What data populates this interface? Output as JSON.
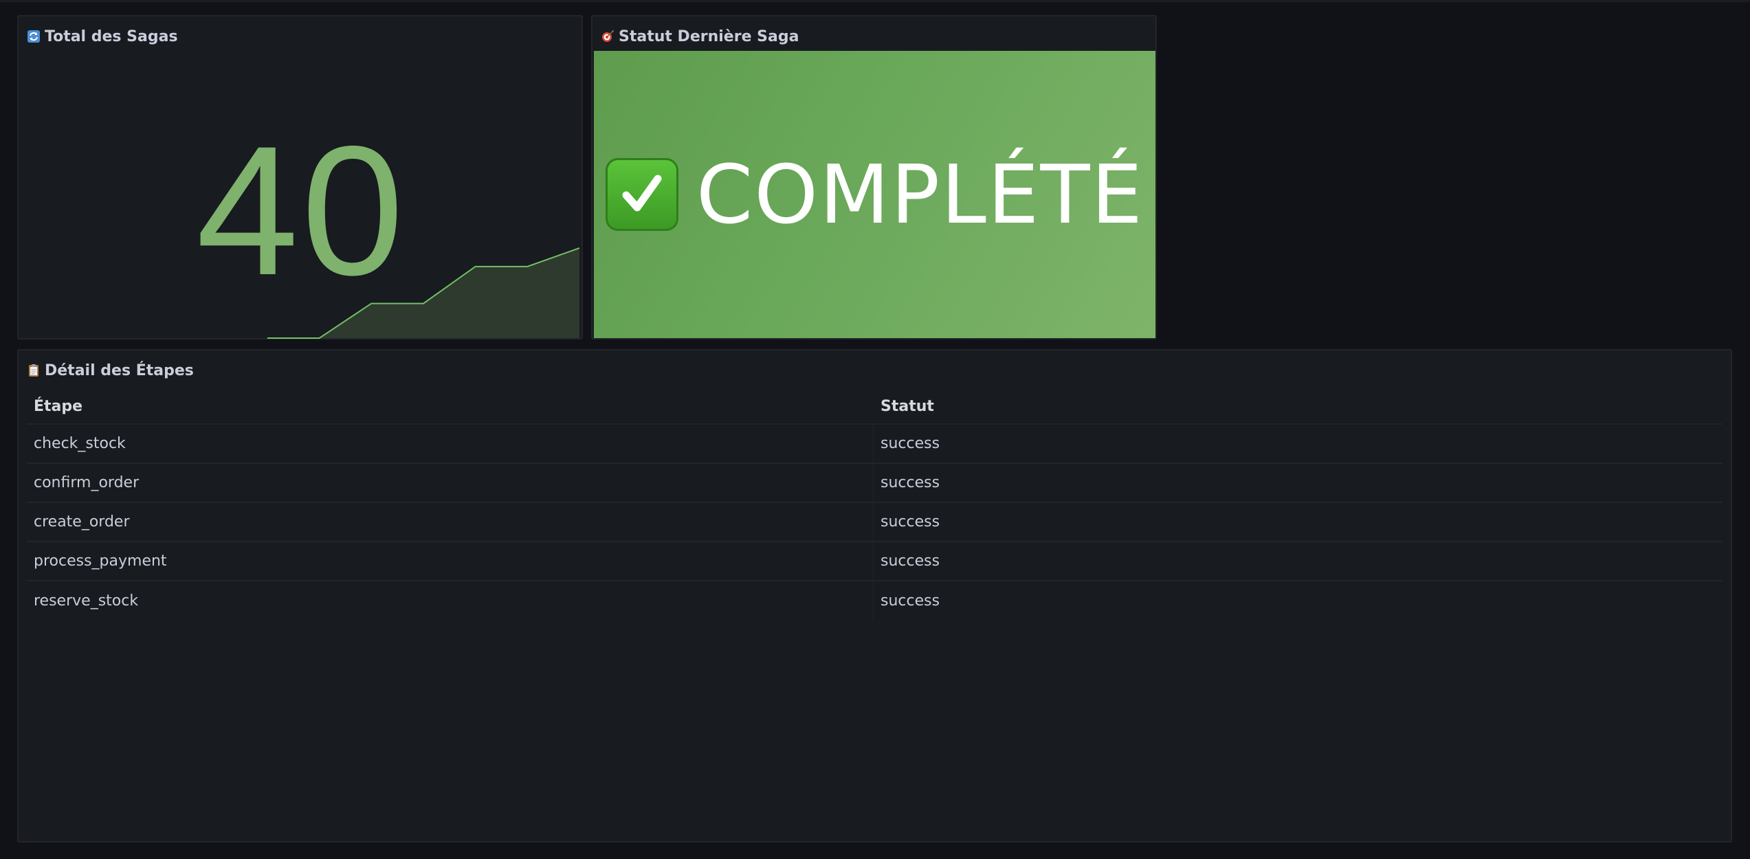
{
  "panels": {
    "total": {
      "title": "Total des Sagas",
      "icon": "refresh-icon",
      "value": "40",
      "value_color": "#7eb26d",
      "sparkline_steps": [
        0,
        0,
        0.3,
        0.3,
        0.62,
        0.62,
        0.78
      ]
    },
    "status": {
      "title": "Statut Dernière Saga",
      "icon": "target-icon",
      "value": "COMPLÉTÉ",
      "check_icon": "check-mark-button-icon",
      "background": "#6aa85a"
    },
    "steps": {
      "title": "Détail des Étapes",
      "icon": "clipboard-icon",
      "columns": [
        "Étape",
        "Statut"
      ],
      "rows": [
        [
          "check_stock",
          "success"
        ],
        [
          "confirm_order",
          "success"
        ],
        [
          "create_order",
          "success"
        ],
        [
          "process_payment",
          "success"
        ],
        [
          "reserve_stock",
          "success"
        ]
      ]
    }
  }
}
